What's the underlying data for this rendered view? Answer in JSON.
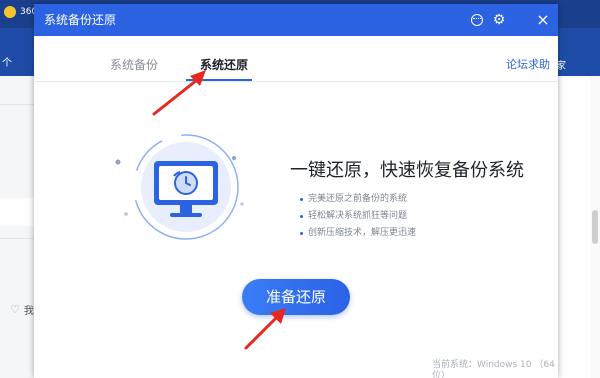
{
  "background_app": {
    "brand_text": "360",
    "nav_left_text": "个",
    "nav_right_text": "家",
    "like_text": "我"
  },
  "dialog": {
    "title": "系统备份还原",
    "titlebar_buttons": [
      "feedback-icon",
      "gear-icon",
      "close-icon"
    ],
    "close_glyph": "×",
    "gear_glyph": "⚙"
  },
  "tabs": [
    {
      "label": "系统备份",
      "active": false
    },
    {
      "label": "系统还原",
      "active": true
    }
  ],
  "forum_link": "论坛求助",
  "hero": {
    "title": "一键还原，快速恢复备份系统",
    "features": [
      "完美还原之前备份的系统",
      "轻松解决系统抓狂等问题",
      "创新压缩技术，解压更迅速"
    ]
  },
  "action_button": "准备还原",
  "os_info": "当前系统：Windows 10 （64位）",
  "colors": {
    "accent": "#2c63e3",
    "titlebar": "#2c63e3",
    "annotation_arrow": "#e8281f"
  }
}
